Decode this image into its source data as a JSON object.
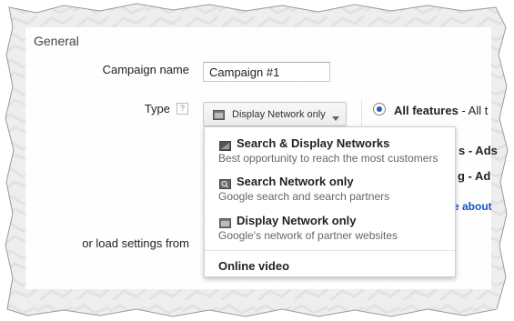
{
  "section_title": "General",
  "campaign_name": {
    "label": "Campaign name",
    "value": "Campaign #1"
  },
  "type": {
    "label": "Type",
    "help": "?",
    "selected": "Display Network only",
    "icon": "network-icon",
    "caret_icon": "caret-down-icon"
  },
  "features": {
    "selected_label": "All features",
    "suffix": "- All t"
  },
  "partial_options": {
    "line1_suffix": "s - Ads",
    "line2_suffix": "g - Ad",
    "learn_more": "e about"
  },
  "load_settings": {
    "label": "or load settings from"
  },
  "dropdown_menu": {
    "items": [
      {
        "title": "Search & Display Networks",
        "description": "Best opportunity to reach the most customers",
        "icon": "search-display-icon"
      },
      {
        "title": "Search Network only",
        "description": "Google search and search partners",
        "icon": "search-network-icon"
      },
      {
        "title": "Display Network only",
        "description": "Google's network of partner websites",
        "icon": "display-network-icon"
      }
    ],
    "extra_item": "Online video"
  },
  "colors": {
    "link": "#1155cc",
    "radio_selected": "#2a5db0",
    "background_texture": "#ececec"
  }
}
